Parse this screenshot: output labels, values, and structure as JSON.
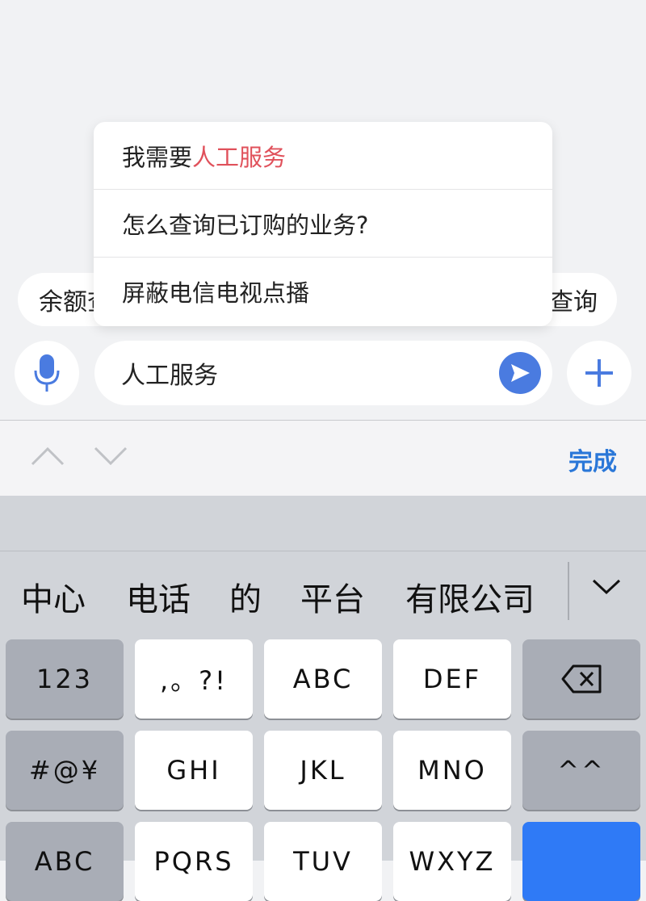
{
  "chips": {
    "left_label": "余额查",
    "right_label": "查询"
  },
  "suggestions": [
    {
      "prefix": "我需要",
      "highlight": "人工服务"
    },
    {
      "prefix": "怎么查询已订购的业务?",
      "highlight": ""
    },
    {
      "prefix": "屏蔽电信电视点播",
      "highlight": ""
    }
  ],
  "input": {
    "value": "人工服务"
  },
  "icons": {
    "mic": "microphone-icon",
    "send": "send-icon",
    "plus": "plus-icon",
    "up": "chevron-up-icon",
    "down": "chevron-down-icon",
    "backspace": "backspace-icon",
    "expand": "chevron-down-icon"
  },
  "accessory": {
    "done_label": "完成"
  },
  "candidates": [
    "中心",
    "电话",
    "的",
    "平台",
    "有限公司"
  ],
  "keys": {
    "row1": [
      "123",
      ",。?!",
      "ABC",
      "DEF"
    ],
    "row2": [
      "#@¥",
      "GHI",
      "JKL",
      "MNO",
      "^^"
    ],
    "row3": [
      "ABC",
      "PQRS",
      "TUV",
      "WXYZ"
    ]
  },
  "colors": {
    "accent": "#2a77d8",
    "highlight": "#e0515b",
    "send": "#4a7be0",
    "mic": "#4a7be0",
    "return_key": "#2f7af6"
  }
}
